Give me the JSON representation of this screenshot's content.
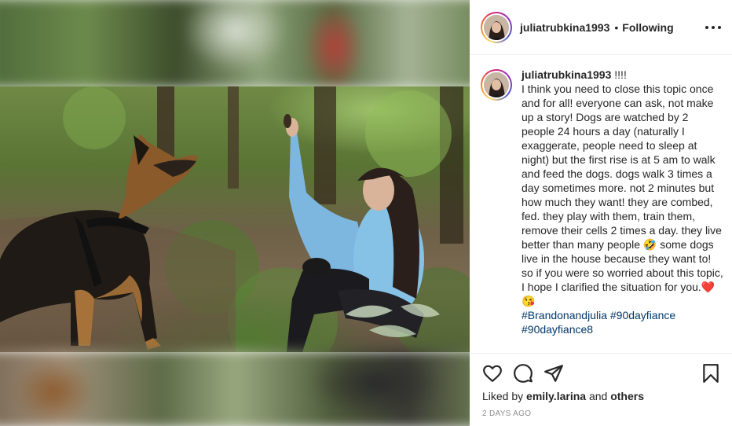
{
  "post": {
    "username": "juliatrubkina1993",
    "follow_separator": "•",
    "follow_state": "Following",
    "caption": {
      "username": "juliatrubkina1993",
      "text_lines": [
        " !!!!",
        "I think you need to close this topic once and for all! everyone can ask, not make up a story! Dogs are watched by 2 people 24 hours a day (naturally I exaggerate, people need to sleep at night) but the first rise is at 5 am to walk and feed the dogs. dogs walk 3 times a day sometimes more. not 2 minutes but how much they want! they are combed, fed. they play with them, train them, remove their cells 2 times a day. they live better than many people 🤣 some dogs live in the house because they want to! so if you were so worried about this topic, I hope I clarified the situation for you.❤️😘"
      ],
      "hashtags": [
        "#Brandonandjulia",
        "#90dayfiance",
        "#90dayfiance8"
      ]
    },
    "liked_by_prefix": "Liked by",
    "liked_by_user": "emily.larina",
    "liked_by_and": "and",
    "liked_by_others": "others",
    "time_ago": "2 DAYS AGO"
  },
  "icons": {
    "like": "heart-icon",
    "comment": "comment-icon",
    "share": "paper-plane-icon",
    "save": "bookmark-icon",
    "more": "more-options-icon"
  }
}
